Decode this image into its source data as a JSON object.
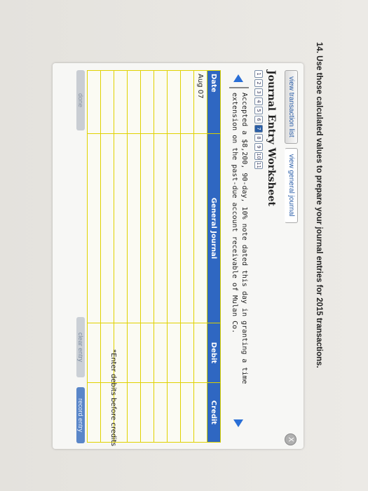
{
  "instruction": "14. Use those calculated values to prepare your journal entries for 2015 transactions.",
  "tabs": [
    "view transaction list",
    "view general journal"
  ],
  "close_label": "X",
  "worksheet_title": "Journal Entry Worksheet",
  "steps": [
    "1",
    "2",
    "3",
    "4",
    "5",
    "6",
    "7",
    "8",
    "9",
    "10",
    "11"
  ],
  "selected_step": 7,
  "description": "Accepted a $8,200, 90-day, 10% note dated this day in granting a time extension on the past-due account receivable of Mulan Co.",
  "table": {
    "headers": {
      "date": "Date",
      "journal": "General Journal",
      "debit": "Debit",
      "credit": "Credit"
    },
    "rows": [
      {
        "date": "Aug 07",
        "journal": "",
        "debit": "",
        "credit": ""
      },
      {
        "date": "",
        "journal": "",
        "debit": "",
        "credit": ""
      },
      {
        "date": "",
        "journal": "",
        "debit": "",
        "credit": ""
      },
      {
        "date": "",
        "journal": "",
        "debit": "",
        "credit": ""
      },
      {
        "date": "",
        "journal": "",
        "debit": "",
        "credit": ""
      },
      {
        "date": "",
        "journal": "",
        "debit": "",
        "credit": ""
      },
      {
        "date": "",
        "journal": "",
        "debit": "",
        "credit": ""
      },
      {
        "date": "",
        "journal": "",
        "debit": "",
        "credit": ""
      },
      {
        "date": "",
        "journal": "",
        "debit": "",
        "credit": ""
      }
    ]
  },
  "hint": "*Enter debits before credits",
  "buttons": {
    "done": "done",
    "clear": "clear entry",
    "record": "record entry"
  }
}
